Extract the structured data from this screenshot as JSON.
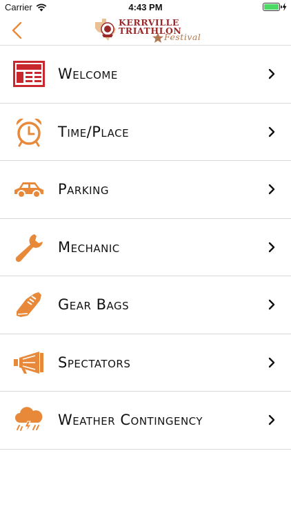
{
  "status_bar": {
    "carrier": "Carrier",
    "time": "4:43 PM",
    "battery_level": 1.0,
    "battery_color": "#4cd964"
  },
  "nav": {
    "back_icon": "chevron-left-icon",
    "logo_line1": "KERRVILLE",
    "logo_line2": "TRIATHLON",
    "logo_line3": "Festival",
    "accent_color": "#e8893a"
  },
  "menu": {
    "items": [
      {
        "label": "Welcome",
        "icon": "newspaper-icon",
        "color": "#c8282d"
      },
      {
        "label": "Time/Place",
        "icon": "alarm-clock-icon",
        "color": "#e8893a"
      },
      {
        "label": "Parking",
        "icon": "car-icon",
        "color": "#e8893a"
      },
      {
        "label": "Mechanic",
        "icon": "wrench-icon",
        "color": "#e8893a"
      },
      {
        "label": "Gear Bags",
        "icon": "shoe-icon",
        "color": "#e8893a"
      },
      {
        "label": "Spectators",
        "icon": "megaphone-icon",
        "color": "#e8893a"
      },
      {
        "label": "Weather Contingency",
        "icon": "storm-cloud-icon",
        "color": "#e8893a"
      }
    ]
  }
}
